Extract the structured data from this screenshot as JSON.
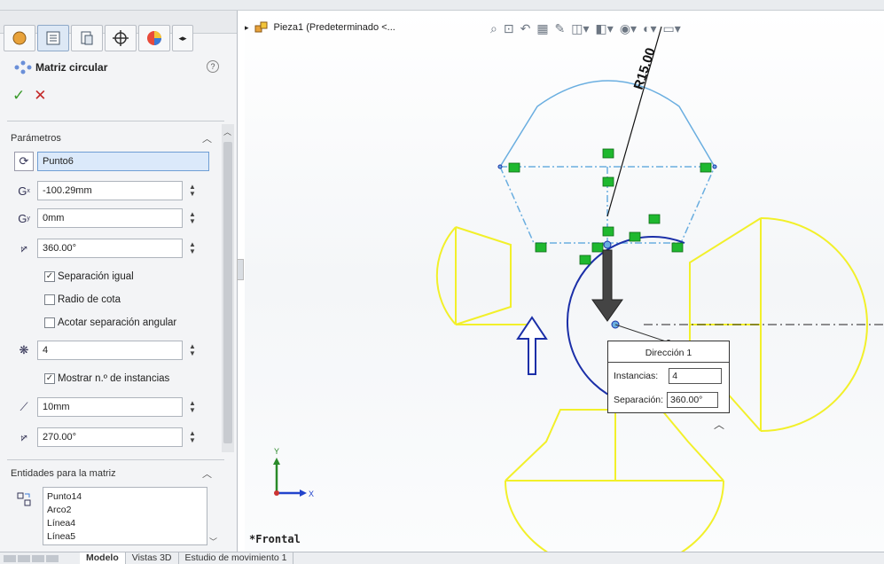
{
  "feature_title": "Matriz circular",
  "ok_symbol": "✓",
  "cancel_symbol": "✕",
  "help_symbol": "?",
  "parameters": {
    "section_title": "Parámetros",
    "center_point": "Punto6",
    "x_value": "-100.29mm",
    "y_value": "0mm",
    "angle_value": "360.00°",
    "equal_spacing": "Separación igual",
    "dimension_radius": "Radio de cota",
    "dimension_angular": "Acotar separación angular",
    "instances": "4",
    "show_instances": "Mostrar n.º de instancias",
    "radius": "10mm",
    "arc_angle": "270.00°"
  },
  "entities": {
    "section_title": "Entidades para la matriz",
    "items": [
      "Punto14",
      "Arco2",
      "Línea4",
      "Línea5"
    ]
  },
  "tree_label": "Pieza1  (Predeterminado <...",
  "sketch_dimension": "R15.00",
  "callout": {
    "title": "Dirección 1",
    "instances_label": "Instancias:",
    "instances_value": "4",
    "spacing_label": "Separación:",
    "spacing_value": "360.00°"
  },
  "view_label": "*Frontal",
  "bottom_tabs": [
    "Modelo",
    "Vistas 3D",
    "Estudio de movimiento 1"
  ],
  "colors": {
    "preview": "#f2f02a",
    "sketch": "#1b2fa8",
    "pattern": "#6aaee0",
    "marker": "#1fb82f"
  }
}
